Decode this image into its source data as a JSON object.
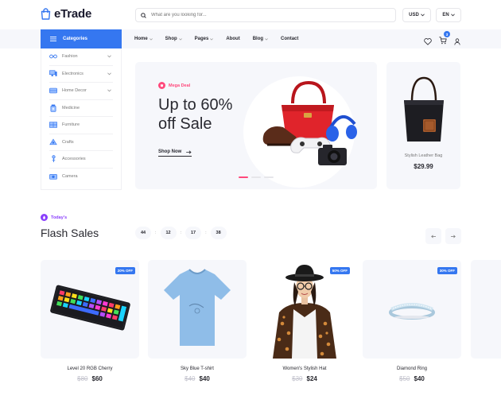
{
  "brand": {
    "name": "eTrade",
    "accent": "#3577f0"
  },
  "search": {
    "placeholder": "What are you looking for..."
  },
  "currency": {
    "selected": "USD"
  },
  "language": {
    "selected": "EN"
  },
  "categories_button": {
    "label": "Categories"
  },
  "menu": [
    {
      "label": "Home",
      "dropdown": true
    },
    {
      "label": "Shop",
      "dropdown": true
    },
    {
      "label": "Pages",
      "dropdown": true
    },
    {
      "label": "About",
      "dropdown": false
    },
    {
      "label": "Blog",
      "dropdown": true
    },
    {
      "label": "Contact",
      "dropdown": false
    }
  ],
  "cart": {
    "count": "3"
  },
  "sidebar": {
    "items": [
      {
        "label": "Fashion",
        "icon": "glasses-icon",
        "has_sub": true
      },
      {
        "label": "Electronics",
        "icon": "computer-icon",
        "has_sub": true
      },
      {
        "label": "Home Decor",
        "icon": "sofa-icon",
        "has_sub": true
      },
      {
        "label": "Medicine",
        "icon": "medicine-icon",
        "has_sub": false
      },
      {
        "label": "Furniture",
        "icon": "furniture-icon",
        "has_sub": false
      },
      {
        "label": "Crafts",
        "icon": "crafts-icon",
        "has_sub": false
      },
      {
        "label": "Accessories",
        "icon": "accessories-icon",
        "has_sub": false
      },
      {
        "label": "Camera",
        "icon": "camera-icon",
        "has_sub": false
      }
    ]
  },
  "hero": {
    "tag": "Mega Deal",
    "title": "Up to 60% off Sale",
    "cta": "Shop Now",
    "slides": 3,
    "active_slide": 1
  },
  "side_product": {
    "name": "Stylish Leather Bag",
    "price": "$29.99"
  },
  "flash": {
    "tag": "Today's",
    "title": "Flash Sales",
    "countdown": [
      "44",
      "12",
      "17",
      "38"
    ],
    "separator": ":"
  },
  "products": [
    {
      "name": "Level 20 RGB Cherry",
      "old_price": "$80",
      "price": "$60",
      "badge": "20% OFF"
    },
    {
      "name": "Sky Blue T-shirt",
      "old_price": "$40",
      "price": "$40",
      "badge": ""
    },
    {
      "name": "Women's Stylish Hat",
      "old_price": "$30",
      "price": "$24",
      "badge": "50% OFF"
    },
    {
      "name": "Diamond Ring",
      "old_price": "$50",
      "price": "$40",
      "badge": "30% OFF"
    }
  ]
}
